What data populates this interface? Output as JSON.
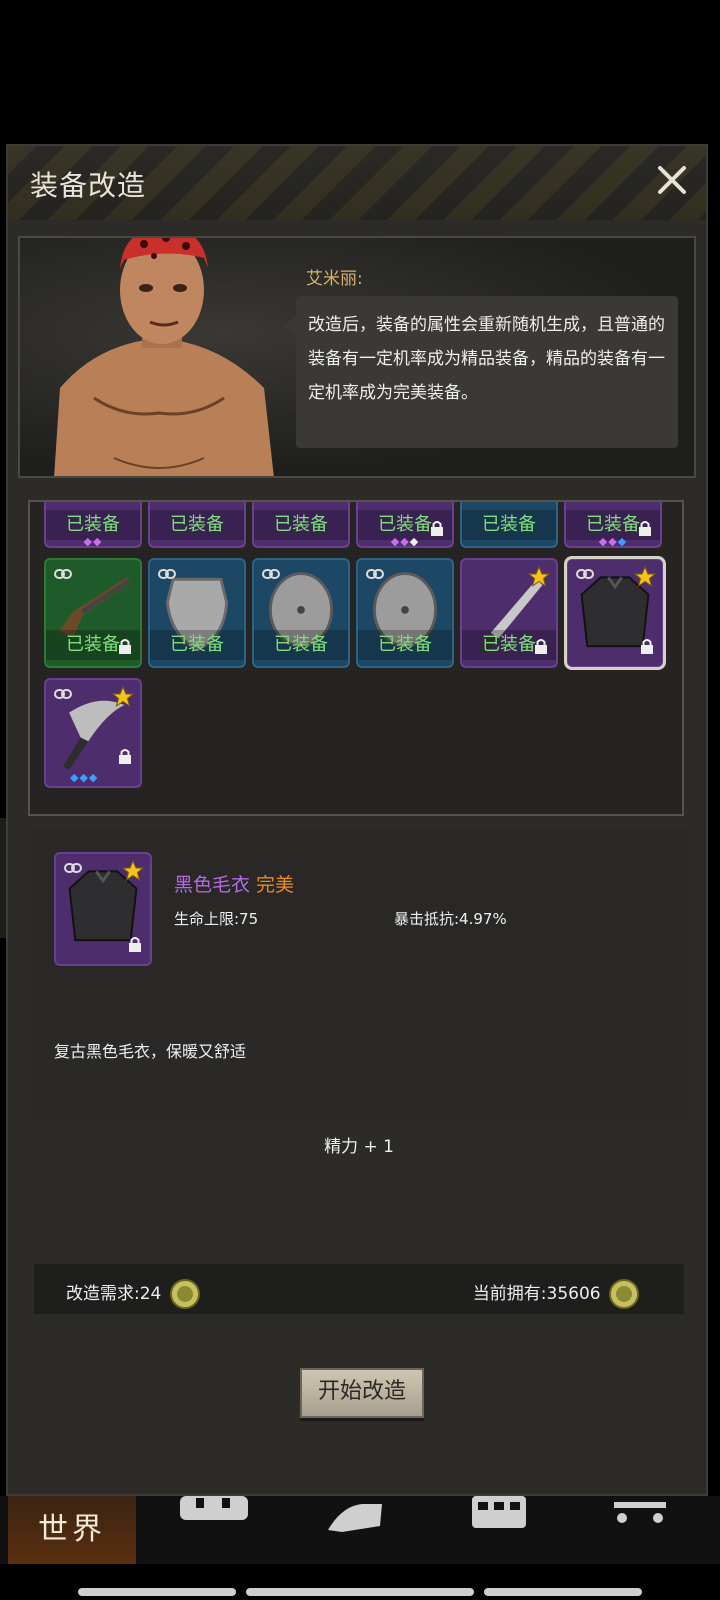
{
  "dialog": {
    "title": "装备改造",
    "npc_name": "艾米丽:",
    "npc_text": "改造后，装备的属性会重新随机生成，且普通的装备有一定机率成为精品装备，精品的装备有一定机率成为完美装备。"
  },
  "inventory": {
    "equipped_label": "已装备"
  },
  "selected_item": {
    "name": "黑色毛衣",
    "quality": "完美",
    "stats": [
      "生命上限:75",
      "暴击抵抗:4.97%"
    ],
    "description": "复古黑色毛衣，保暖又舒适"
  },
  "bonus": "精力 + 1",
  "cost": {
    "required_label": "改造需求:24",
    "owned_label": "当前拥有:35606"
  },
  "actions": {
    "start_label": "开始改造"
  },
  "tabs": {
    "world_label": "世界"
  },
  "colors": {
    "quality_perfect": "#f08a1a",
    "item_name_purple": "#b46be0",
    "equipped_green": "#7fe07a"
  }
}
